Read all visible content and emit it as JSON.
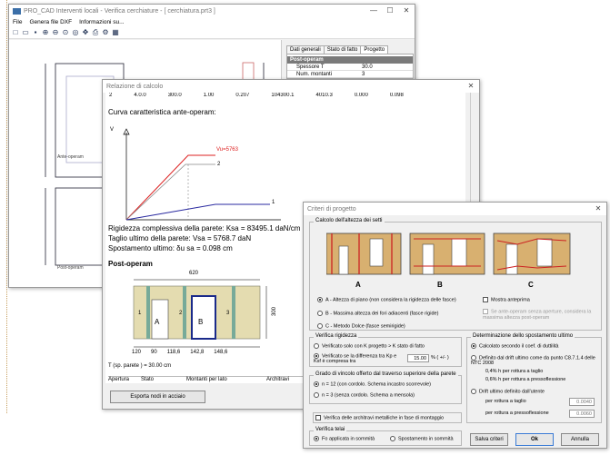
{
  "main_window": {
    "title": "PRO_CAD Interventi locali - Verifica cerchiature - [ cerchiatura.prt3 ]",
    "menu": [
      "File",
      "Genera file DXF",
      "Informazioni su..."
    ],
    "icons": [
      "new-icon",
      "open-icon",
      "save-icon",
      "zoom-in-icon",
      "zoom-out-icon",
      "zoom-window-icon",
      "zoom-all-icon",
      "pan-icon",
      "print-icon",
      "settings-icon",
      "display-icon"
    ],
    "panel_tabs": [
      "Dati generali",
      "Stato di fatto",
      "Progetto"
    ],
    "post_section": "Post-operam",
    "props": [
      {
        "k": "Spessore T",
        "v": "30.0"
      },
      {
        "k": "Num. montanti",
        "v": "3"
      }
    ],
    "drawing_labels": {
      "ante": "Ante-operam",
      "post": "Post-operam"
    }
  },
  "report_window": {
    "title": "Relazione di calcolo",
    "top_row": [
      "2",
      "4.0.0",
      "300.0",
      "1.00",
      "0.207",
      "104300.1",
      "4010.3",
      "0.000",
      "0.098"
    ],
    "curve_title": "Curva caratteristica ante-operam:",
    "axis_v": "V",
    "curve_labels": {
      "vu": "Vu=5763",
      "c2": "2",
      "c1": "1"
    },
    "ksa": "Rigidezza complessiva della parete: Ksa = 83495.1 daN/cm",
    "vsa": "Taglio ultimo della parete: Vsa = 5768.7 daN",
    "spost": "Spostamento ultimo: δu sa = 0.098 cm",
    "post_title": "Post-operam",
    "width_total": "620",
    "height_total": "300",
    "pier_labels": [
      "1",
      "2",
      "3"
    ],
    "opening_labels": [
      "A",
      "B"
    ],
    "dims": [
      "120",
      "90",
      "118,6",
      "142,8",
      "148,6"
    ],
    "thickness": "T (sp. parete ) = 30.00 cm",
    "table_headers": [
      "Apertura",
      "Stato",
      "Montanti per lato",
      "Architravi"
    ],
    "export_button": "Esporta nodi in acciaio"
  },
  "criteria_window": {
    "title": "Criteri di progetto",
    "group_height": "Calcolo dell'altezza dei setti",
    "figure_labels": [
      "A",
      "B",
      "C"
    ],
    "height_options": [
      "A - Altezza di piano (non considera la rigidezza delle fasce)",
      "B - Massima altezza dei fori adiacenti (fasce rigide)",
      "C - Metodo Dolce (fasce semirigide)"
    ],
    "show_preview": "Mostra anteprima",
    "ante_no_openings": "Se ante-operam senza aperture, considera la massima altezza post-operam",
    "group_stiffness": "Verifica rigidezza",
    "stiffness_opt1": "Verificato solo con   K progetto > K stato di fatto",
    "stiffness_opt2": "Verificato se la differenza tra Kp e Ksf è compresa tra",
    "stiffness_value": "15.00",
    "stiffness_unit": "% ( +/- )",
    "group_constraint": "Grado di vincolo offerto dal traverso superiore della parete",
    "constraint_opts": [
      "n = 12 (con cordolo. Schema incastro scorrevole)",
      "n = 3  (senza cordolo. Schema a mensola)"
    ],
    "lintel_check": "Verifica delle architravi metalliche  in fase di montaggio",
    "group_frame": "Verifica telai",
    "frame_opts": [
      "Fo applicata in sommità",
      "Spostamento in sommità"
    ],
    "group_disp": "Determinazione dello spostamento ultimo",
    "disp_opt1": "Calcolato secondo il coef. di duttilità",
    "disp_opt2": "Definito dal drift ultimo come da punto C8.7.1.4 delle  NTC 2008",
    "drift_shear": "0,4% h   per rottura a taglio",
    "drift_bend": "0,6% h   per rottura a pressoflessione",
    "disp_opt3": "Drift ultimo definito dall'utente",
    "user_shear_label": "per rottura a taglio",
    "user_shear_val": "0.0040",
    "user_bend_label": "per rottura a pressoflessione",
    "user_bend_val": "0.0060",
    "btn_save": "Salva criteri",
    "btn_ok": "Ok",
    "btn_cancel": "Annulla"
  }
}
